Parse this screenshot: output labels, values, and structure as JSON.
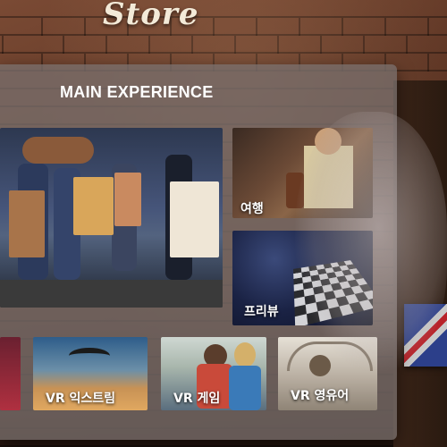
{
  "environment": {
    "store_sign": "Store"
  },
  "panel": {
    "title": "MAIN EXPERIENCE",
    "tiles": {
      "travel": "여행",
      "free": "프리뷰",
      "vr_extreme": "VR 익스트림",
      "vr_game": "VR 게임",
      "vr_museum": "VR 영유어"
    }
  }
}
